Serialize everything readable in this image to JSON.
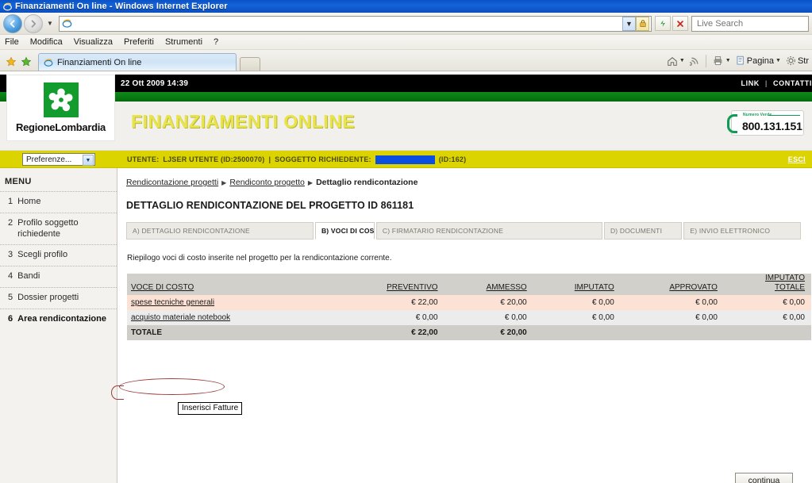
{
  "browser": {
    "title": "Finanziamenti On line - Windows Internet Explorer",
    "title_icon": "ie-logo-icon",
    "address_value": "",
    "address_placeholder": "",
    "search_placeholder": "Live Search",
    "nav": {
      "back_icon": "back-arrow-icon",
      "forward_icon": "forward-arrow-icon",
      "history_caret_icon": "chevron-down-icon",
      "address_dropdown_icon": "chevron-down-icon",
      "lock_icon": "padlock-icon",
      "refresh_icon": "refresh-icon",
      "stop_icon": "stop-x-icon"
    },
    "menu": [
      "File",
      "Modifica",
      "Visualizza",
      "Preferiti",
      "Strumenti",
      "?"
    ],
    "favorites": {
      "add_icon": "star-icon",
      "favorites_icon": "star-plus-icon"
    },
    "tab": {
      "label": "Finanziamenti On line",
      "icon": "ie-page-icon"
    },
    "newtab_name": "new-tab-button",
    "toolbar_right": [
      {
        "label": "",
        "icon": "home-icon",
        "caret": true
      },
      {
        "label": "",
        "icon": "rss-icon",
        "caret": false
      },
      {
        "label": "",
        "icon": "print-icon",
        "caret": true
      },
      {
        "label": "Pagina",
        "icon": "page-icon",
        "caret": true
      },
      {
        "label": "Str",
        "icon": "gear-icon",
        "caret": false
      }
    ]
  },
  "site": {
    "topbar": {
      "datetime": "22 Ott 2009 14:39",
      "links": [
        "LINK",
        "CONTATTI"
      ],
      "separator": "|"
    },
    "banner": {
      "title": "FINANZIAMENTI ONLINE",
      "logo_mark": "rosa-camuna-icon",
      "logo_name": "RegioneLombardia",
      "numero_verde_label": "Numero Verde",
      "numero_verde_number": "800.131.151"
    },
    "userbar": {
      "preferences_value": "Preferenze...",
      "utente_label": "UTENTE:",
      "utente_value": "LJSER UTENTE (ID:2500070)",
      "divider": "|",
      "soggetto_label": "SOGGETTO RICHIEDENTE:",
      "soggetto_value_redacted": "",
      "soggetto_id": "(ID:162)",
      "logout_label": "ESCI"
    },
    "sidebar": {
      "title": "MENU",
      "items": [
        {
          "num": "1",
          "label": "Home",
          "active": false
        },
        {
          "num": "2",
          "label": "Profilo soggetto richiedente",
          "active": false
        },
        {
          "num": "3",
          "label": "Scegli profilo",
          "active": false
        },
        {
          "num": "4",
          "label": "Bandi",
          "active": false
        },
        {
          "num": "5",
          "label": "Dossier progetti",
          "active": false
        },
        {
          "num": "6",
          "label": "Area rendicontazione",
          "active": true
        }
      ]
    },
    "breadcrumb": {
      "items": [
        {
          "label": "Rendicontazione progetti",
          "link": true
        },
        {
          "label": "Rendiconto progetto",
          "link": true
        },
        {
          "label": "Dettaglio rendicontazione",
          "link": false
        }
      ],
      "separator": "▶"
    },
    "page_title": "DETTAGLIO RENDICONTAZIONE DEL PROGETTO ID 861181",
    "tabs": [
      {
        "label": "A) DETTAGLIO RENDICONTAZIONE",
        "active": false
      },
      {
        "label": "B) VOCI DI COSTO",
        "active": true
      },
      {
        "label": "C) FIRMATARIO RENDICONTAZIONE",
        "active": false
      },
      {
        "label": "D) DOCUMENTI",
        "active": false
      },
      {
        "label": "E) INVIO ELETTRONICO",
        "active": false
      }
    ],
    "intro_text": "Riepilogo voci di costo inserite nel progetto per la rendicontazione corrente.",
    "table": {
      "headers": [
        "VOCE DI COSTO",
        "PREVENTIVO",
        "AMMESSO",
        "IMPUTATO",
        "APPROVATO",
        "IMPUTATO TOTALE"
      ],
      "header_imputato_totale_line1": "IMPUTATO",
      "header_imputato_totale_line2": "TOTALE",
      "rows": [
        {
          "voce": "spese tecniche generali",
          "voce_is_link": true,
          "preventivo": "€ 22,00",
          "ammesso": "€ 20,00",
          "imputato": "€ 0,00",
          "approvato": "€ 0,00",
          "imputato_totale": "€ 0,00",
          "highlight": true
        },
        {
          "voce": "acquisto materiale notebook",
          "voce_is_link": true,
          "preventivo": "€ 0,00",
          "ammesso": "€ 0,00",
          "imputato": "€ 0,00",
          "approvato": "€ 0,00",
          "imputato_totale": "€ 0,00",
          "highlight": false
        }
      ],
      "total_row": {
        "voce": "TOTALE",
        "preventivo": "€ 22,00",
        "ammesso": "€ 20,00",
        "imputato": "",
        "approvato": "",
        "imputato_totale": ""
      }
    },
    "continua_label": "continua",
    "tooltip_text": "Inserisci Fatture"
  },
  "colors": {
    "brand_green": "#139c2e",
    "banner_yellow": "#e8e44a",
    "userbar_yellow": "#dcd400",
    "row_highlight": "#fbe2d4",
    "annotation_red": "#9d3b3b",
    "redaction_blue": "#0b4fe0"
  }
}
